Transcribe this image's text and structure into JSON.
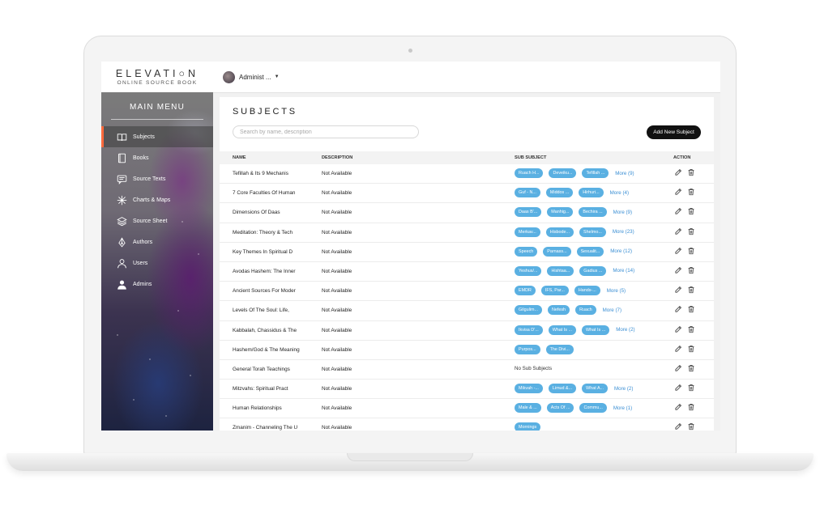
{
  "logo": {
    "title": "ELEVATI○N",
    "subtitle": "ONLINE SOURCE BOOK"
  },
  "header": {
    "user_name": "Administ ..."
  },
  "sidebar": {
    "title": "MAIN MENU",
    "items": [
      {
        "label": "Subjects",
        "icon": "book-open-icon",
        "active": true
      },
      {
        "label": "Books",
        "icon": "book-icon"
      },
      {
        "label": "Source Texts",
        "icon": "chat-icon"
      },
      {
        "label": "Charts & Maps",
        "icon": "sparkle-icon"
      },
      {
        "label": "Source Sheet",
        "icon": "layers-icon"
      },
      {
        "label": "Authors",
        "icon": "pen-nib-icon"
      },
      {
        "label": "Users",
        "icon": "user-outline-icon"
      },
      {
        "label": "Admins",
        "icon": "user-filled-icon"
      }
    ]
  },
  "page": {
    "title": "SUBJECTS",
    "search_placeholder": "Search by name, description",
    "add_button": "Add New Subject"
  },
  "table": {
    "columns": {
      "name": "NAME",
      "description": "DESCRIPTION",
      "sub_subject": "SUB SUBJECT",
      "action": "ACTION"
    },
    "rows": [
      {
        "name": "Tefillah & Its 9 Mechanis",
        "description": "Not Available",
        "chips": [
          "Ruach H...",
          "Deveiku...",
          "Tefillah ..."
        ],
        "more": "More (9)"
      },
      {
        "name": "7 Core Faculties Of Human",
        "description": "Not Available",
        "chips": [
          "Guf - N...",
          "Middos ...",
          "Hirhuri..."
        ],
        "more": "More (4)"
      },
      {
        "name": "Dimensions Of Daas",
        "description": "Not Available",
        "chips": [
          "Daas B'...",
          "Manhig...",
          "Bechira ..."
        ],
        "more": "More (9)"
      },
      {
        "name": "Meditation: Theory & Tech",
        "description": "Not Available",
        "chips": [
          "Merkav...",
          "Hisbode...",
          "Shelmo..."
        ],
        "more": "More (23)"
      },
      {
        "name": "Key Themes In Spiritual D",
        "description": "Not Available",
        "chips": [
          "Speech",
          "Parnass...",
          "Sexualit..."
        ],
        "more": "More (12)"
      },
      {
        "name": "Avodas Hashem: The Inner",
        "description": "Not Available",
        "chips": [
          "Yeshus/...",
          "Hishtaa...",
          "Gadius ..."
        ],
        "more": "More (14)"
      },
      {
        "name": "Ancient Sources For Moder",
        "description": "Not Available",
        "chips": [
          "EMDR",
          "IFS, Par...",
          "Hands-..."
        ],
        "more": "More (5)"
      },
      {
        "name": "Levels Of The Soul: Life,",
        "description": "Not Available",
        "chips": [
          "Gilgulim...",
          "Nefesh",
          "Ruach"
        ],
        "more": "More (7)"
      },
      {
        "name": "Kabbalah, Chassidus & The",
        "description": "Not Available",
        "chips": [
          "Ikvisa D'...",
          "What Is ...",
          "What Is ..."
        ],
        "more": "More (2)"
      },
      {
        "name": "Hashem/God & The Meaning",
        "description": "Not Available",
        "chips": [
          "Purpos...",
          "The Divi..."
        ],
        "more": ""
      },
      {
        "name": "General Torah Teachings",
        "description": "Not Available",
        "chips": [],
        "more": "",
        "no_sub": "No Sub Subjects"
      },
      {
        "name": "Mitzvahs: Spiritual Pract",
        "description": "Not Available",
        "chips": [
          "Mikvah -...",
          "Limud &...",
          "What A..."
        ],
        "more": "More (2)"
      },
      {
        "name": "Human Relationships",
        "description": "Not Available",
        "chips": [
          "Male & ...",
          "Acts Of ...",
          "Commu..."
        ],
        "more": "More (1)"
      },
      {
        "name": "Zmanim - Channeling The U",
        "description": "Not Available",
        "chips": [
          "Mornings"
        ],
        "more": ""
      }
    ]
  },
  "colors": {
    "accent": "#ff6a3d",
    "chip": "#5ab0e2",
    "link": "#3b8fd4",
    "button": "#111111"
  }
}
